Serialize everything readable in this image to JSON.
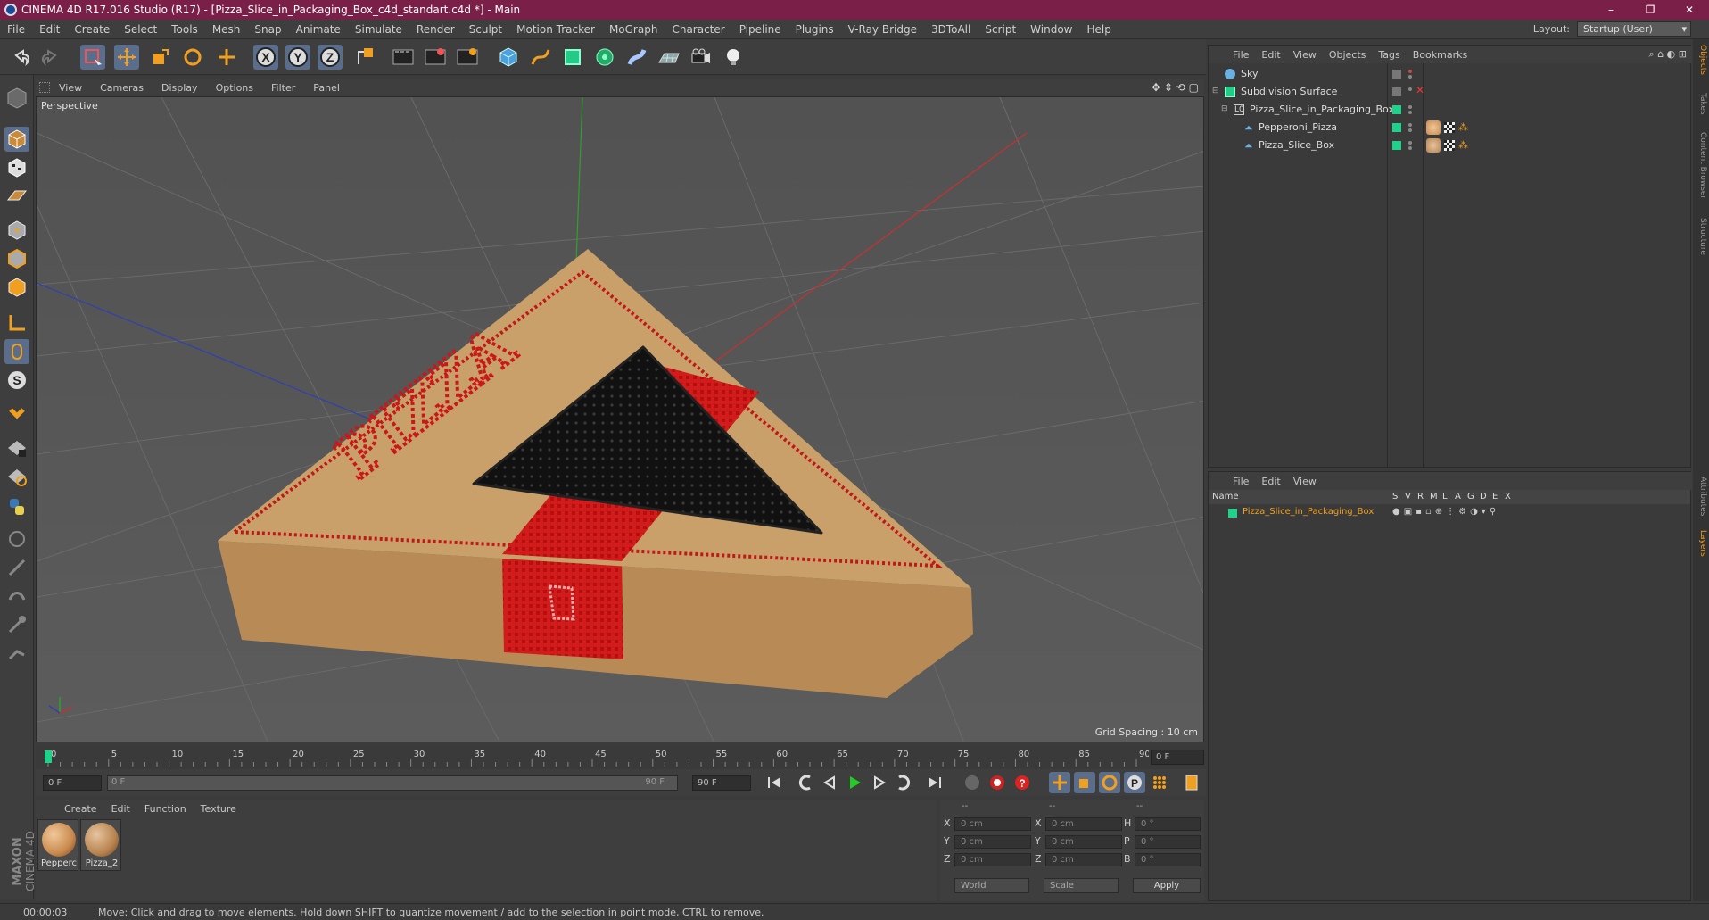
{
  "window": {
    "title": "CINEMA 4D R17.016 Studio (R17) - [Pizza_Slice_in_Packaging_Box_c4d_standart.c4d *] - Main",
    "controls": [
      "–",
      "❐",
      "✕"
    ]
  },
  "menubar": {
    "items": [
      "File",
      "Edit",
      "Create",
      "Select",
      "Tools",
      "Mesh",
      "Snap",
      "Animate",
      "Simulate",
      "Render",
      "Sculpt",
      "Motion Tracker",
      "MoGraph",
      "Character",
      "Pipeline",
      "Plugins",
      "V-Ray Bridge",
      "3DToAll",
      "Script",
      "Window",
      "Help"
    ],
    "layout_label": "Layout:",
    "layout_value": "Startup (User)"
  },
  "toolbar": {
    "icons": [
      "undo-icon",
      "redo-icon",
      "live-selection-icon",
      "move-icon",
      "scale-icon",
      "rotate-icon",
      "move-cross-icon",
      "x-axis-icon",
      "y-axis-icon",
      "z-axis-icon",
      "world-coord-icon",
      "render-view-icon",
      "render-active-icon",
      "render-settings-icon",
      "cube-icon",
      "pen-spline-icon",
      "subdivision-icon",
      "array-icon",
      "deformer-icon",
      "floor-icon",
      "camera-icon",
      "light-icon"
    ],
    "axis_labels": [
      "X",
      "Y",
      "Z"
    ]
  },
  "viewport": {
    "menu": [
      "View",
      "Cameras",
      "Display",
      "Options",
      "Filter",
      "Panel"
    ],
    "label": "Perspective",
    "grid_spacing": "Grid Spacing : 10 cm",
    "box_text": "PIZZA"
  },
  "timeline": {
    "ticks": [
      "0",
      "5",
      "10",
      "15",
      "20",
      "25",
      "30",
      "35",
      "40",
      "45",
      "50",
      "55",
      "60",
      "65",
      "70",
      "75",
      "80",
      "85",
      "90"
    ],
    "current_frame": "0 F",
    "start_field": "0 F",
    "range_start": "0 F",
    "range_end": "90 F",
    "end_field": "90 F"
  },
  "materials": {
    "menu": [
      "Create",
      "Edit",
      "Function",
      "Texture"
    ],
    "items": [
      {
        "label": "Pepperc",
        "color": "#c98a4e"
      },
      {
        "label": "Pizza_2",
        "color": "#b8834f"
      }
    ]
  },
  "coordinates": {
    "header": [
      "--",
      "--",
      "--"
    ],
    "rows": [
      {
        "a": "X",
        "av": "0 cm",
        "b": "X",
        "bv": "0 cm",
        "c": "H",
        "cv": "0 °"
      },
      {
        "a": "Y",
        "av": "0 cm",
        "b": "Y",
        "bv": "0 cm",
        "c": "P",
        "cv": "0 °"
      },
      {
        "a": "Z",
        "av": "0 cm",
        "b": "Z",
        "bv": "0 cm",
        "c": "B",
        "cv": "0 °"
      }
    ],
    "world": "World",
    "scale": "Scale",
    "apply": "Apply"
  },
  "objects": {
    "menu": [
      "File",
      "Edit",
      "View",
      "Objects",
      "Tags",
      "Bookmarks"
    ],
    "items": [
      {
        "name": "Sky",
        "icon": "sky-icon"
      },
      {
        "name": "Subdivision Surface",
        "icon": "subdivision-icon"
      },
      {
        "name": "Pizza_Slice_in_Packaging_Box",
        "icon": "null-icon"
      },
      {
        "name": "Pepperoni_Pizza",
        "icon": "polygon-icon"
      },
      {
        "name": "Pizza_Slice_Box",
        "icon": "polygon-icon"
      }
    ]
  },
  "layers": {
    "menu": [
      "File",
      "Edit",
      "View"
    ],
    "header": {
      "name": "Name",
      "cols": [
        "S",
        "V",
        "R",
        "M",
        "L",
        "A",
        "G",
        "D",
        "E",
        "X"
      ]
    },
    "items": [
      {
        "name": "Pizza_Slice_in_Packaging_Box",
        "color": "#1fd18a"
      }
    ]
  },
  "right_tabs": [
    "Objects",
    "Takes",
    "Content Browser",
    "Structure",
    "Attributes",
    "Layers"
  ],
  "status": {
    "time": "00:00:03",
    "message": "Move: Click and drag to move elements. Hold down SHIFT to quantize movement / add to the selection in point mode, CTRL to remove."
  },
  "colors": {
    "titlebar": "#7a1f48",
    "accent_green": "#1fd18a",
    "axis_x": "#c83030",
    "axis_y": "#30a030",
    "axis_z": "#3040b0",
    "box_cardboard": "#c9a06a",
    "box_red": "#d21c1c"
  }
}
